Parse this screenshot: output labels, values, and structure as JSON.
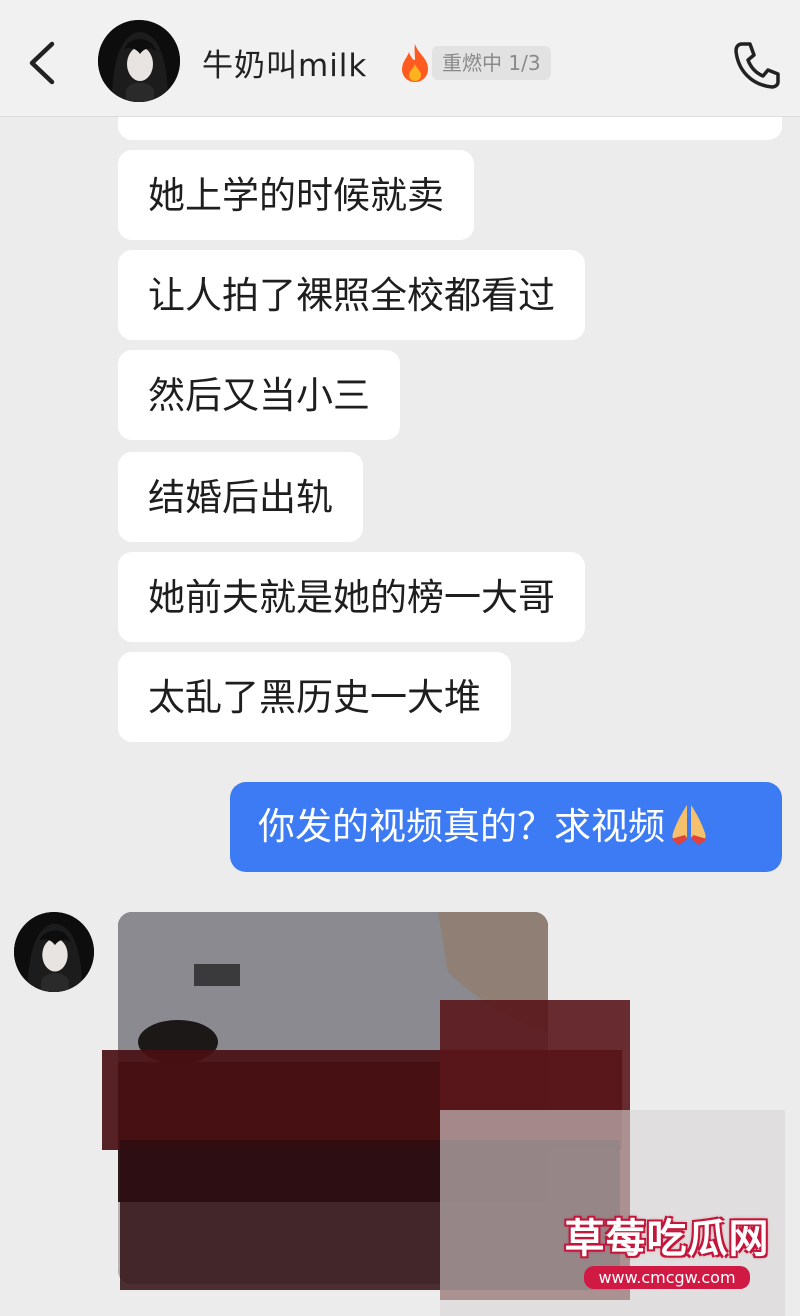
{
  "header": {
    "contact_name": "牛奶叫milk",
    "status_badge": "重燃中 1/3"
  },
  "icons": {
    "back": "chevron-left-icon",
    "flame": "flame-icon",
    "call": "phone-icon",
    "pray": "folded-hands-icon"
  },
  "messages": {
    "received": [
      "她上学的时候就卖",
      "让人拍了裸照全校都看过",
      "然后又当小三",
      "结婚后出轨",
      "她前夫就是她的榜一大哥",
      "太乱了黑历史一大堆"
    ],
    "sent": "你发的视频真的？求视频"
  },
  "watermark": {
    "title": "草莓吃瓜网",
    "url": "www.cmcgw.com"
  },
  "colors": {
    "sent_bubble": "#3c7bf3",
    "received_bubble": "#ffffff",
    "background": "#ececec",
    "flame": "#ff5a1f"
  }
}
